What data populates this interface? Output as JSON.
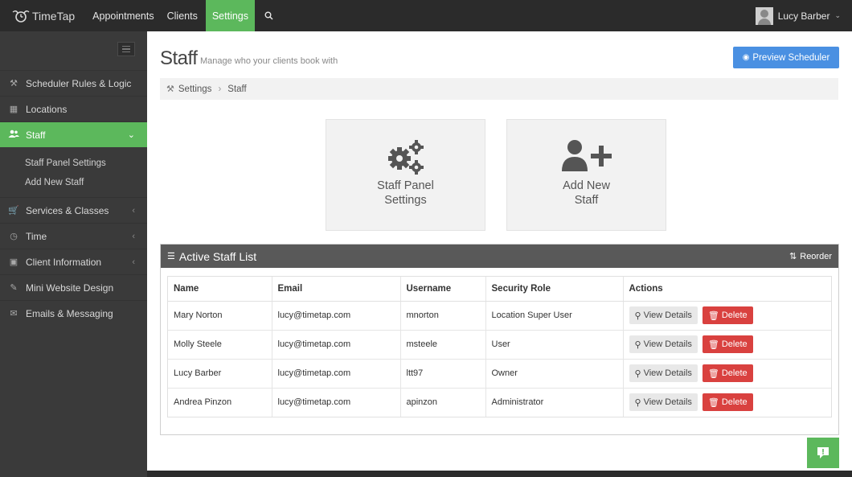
{
  "app": {
    "name": "TimeTap"
  },
  "nav": {
    "items": [
      {
        "label": "Appointments"
      },
      {
        "label": "Clients"
      },
      {
        "label": "Settings"
      }
    ]
  },
  "user": {
    "name": "Lucy Barber"
  },
  "sidebar": {
    "items": [
      {
        "label": "Scheduler Rules & Logic",
        "icon": "wrench-icon"
      },
      {
        "label": "Locations",
        "icon": "building-icon"
      },
      {
        "label": "Staff",
        "icon": "users-icon"
      },
      {
        "label": "Services & Classes",
        "icon": "cart-icon"
      },
      {
        "label": "Time",
        "icon": "clock-icon"
      },
      {
        "label": "Client Information",
        "icon": "id-card-icon"
      },
      {
        "label": "Mini Website Design",
        "icon": "edit-icon"
      },
      {
        "label": "Emails & Messaging",
        "icon": "envelope-icon"
      }
    ],
    "staff_sub": [
      {
        "label": "Staff Panel Settings"
      },
      {
        "label": "Add New Staff"
      }
    ]
  },
  "page": {
    "title": "Staff",
    "subtitle": "Manage who your clients book with",
    "preview_button": "Preview Scheduler"
  },
  "breadcrumb": {
    "parent": "Settings",
    "current": "Staff"
  },
  "tiles": {
    "panel_settings": {
      "line1": "Staff Panel",
      "line2": "Settings"
    },
    "add_staff": {
      "line1": "Add New",
      "line2": "Staff"
    }
  },
  "staff_list": {
    "title": "Active Staff List",
    "reorder_label": "Reorder",
    "columns": [
      "Name",
      "Email",
      "Username",
      "Security Role",
      "Actions"
    ],
    "rows": [
      {
        "name": "Mary Norton",
        "email": "lucy@timetap.com",
        "username": "mnorton",
        "role": "Location Super User"
      },
      {
        "name": "Molly Steele",
        "email": "lucy@timetap.com",
        "username": "msteele",
        "role": "User"
      },
      {
        "name": "Lucy Barber",
        "email": "lucy@timetap.com",
        "username": "ltt97",
        "role": "Owner"
      },
      {
        "name": "Andrea Pinzon",
        "email": "lucy@timetap.com",
        "username": "apinzon",
        "role": "Administrator"
      }
    ],
    "view_label": "View Details",
    "delete_label": "Delete"
  },
  "colors": {
    "accent_green": "#5cb85c",
    "primary_blue": "#4a90e2",
    "danger_red": "#d9413f",
    "topbar": "#2b2b2b",
    "sidebar": "#3a3a3a"
  }
}
